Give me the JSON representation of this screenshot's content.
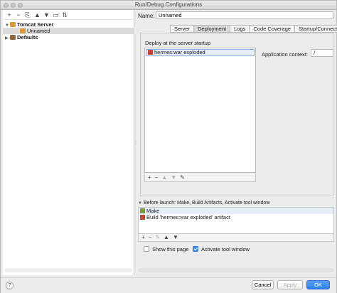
{
  "window": {
    "title": "Run/Debug Configurations"
  },
  "left_toolbar": {
    "add": "+",
    "remove": "−",
    "copy": "⎘",
    "move_up": "▲",
    "move_down": "▼",
    "folder": "▭",
    "sort": "⇅"
  },
  "tree": {
    "tomcat_server": {
      "label": "Tomcat Server",
      "icon": "tomcat-icon"
    },
    "unnamed": {
      "label": "Unnamed",
      "icon": "tomcat-icon"
    },
    "defaults": {
      "label": "Defaults",
      "icon": "defaults-icon"
    }
  },
  "name": {
    "label": "Name:",
    "value": "Unnamed"
  },
  "tabs": [
    {
      "label": "Server"
    },
    {
      "label": "Deployment"
    },
    {
      "label": "Logs"
    },
    {
      "label": "Code Coverage"
    },
    {
      "label": "Startup/Connectio"
    }
  ],
  "active_tab": "Deployment",
  "deployment": {
    "section_label": "Deploy at the server startup",
    "artifacts": [
      {
        "label": "hermes:war exploded",
        "icon": "artifact-icon"
      }
    ],
    "toolbar": {
      "add": "+",
      "remove": "−",
      "up": "▲",
      "down": "▼",
      "edit": "✎"
    },
    "application_context": {
      "label": "Application context:",
      "value": "/"
    }
  },
  "before_launch": {
    "header": "Before launch: Make, Build Artifacts, Activate tool window",
    "tasks": [
      {
        "label": "Make",
        "icon": "make-icon"
      },
      {
        "label": "Build 'hermes:war exploded' artifact",
        "icon": "build-icon"
      }
    ],
    "toolbar": {
      "add": "+",
      "remove": "−",
      "edit": "✎",
      "up": "▲",
      "down": "▼"
    }
  },
  "options": {
    "show_this_page": {
      "label": "Show this page",
      "checked": false
    },
    "activate_tool_window": {
      "label": "Activate tool window",
      "checked": true
    }
  },
  "footer": {
    "help": "?",
    "cancel": "Cancel",
    "apply": "Apply",
    "ok": "OK"
  },
  "colors": {
    "accent": "#3e8ef0",
    "selection": "#e6eefb",
    "selection_border": "#8ab0e6"
  }
}
